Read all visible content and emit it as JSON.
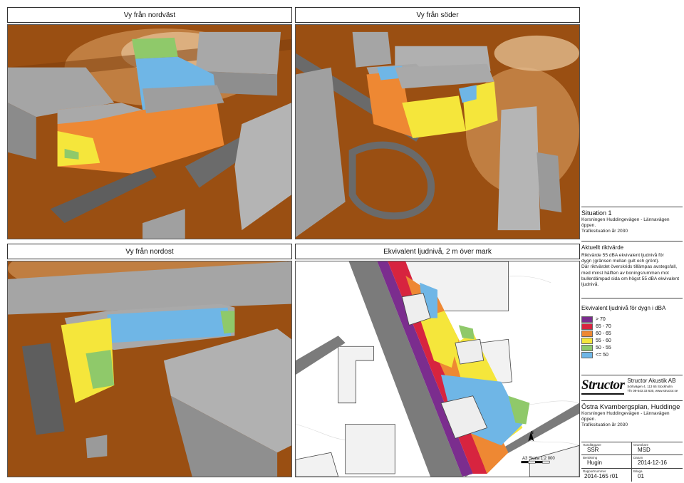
{
  "views": {
    "nw": {
      "title": "Vy från nordväst"
    },
    "s": {
      "title": "Vy från söder"
    },
    "ne": {
      "title": "Vy från nordost"
    },
    "map": {
      "title": "Ekvivalent ljudnivå, 2 m över mark"
    }
  },
  "situation": {
    "heading": "Situation 1",
    "line1": "Korsningen Huddingevägen - Lännavägen",
    "line2": "öppen.",
    "line3": "Trafiksituation år 2030"
  },
  "guideline": {
    "heading": "Aktuellt riktvärde",
    "lines": [
      "Riktvärde 55 dBA ekvivalent ljudnivå för",
      "dygn (gränsen mellan gult och grönt).",
      "Där riktvärdet överskrids tillämpas avstegsfall,",
      "med minst hälften av boningsrummen mot",
      "bullerdämpad sida om högst 55 dBA ekvivalent",
      "ljudnivå."
    ]
  },
  "legend": {
    "heading": "Ekvivalent ljudnivå för dygn i dBA",
    "items": [
      {
        "label": "> 70",
        "color": "#7b2d8e"
      },
      {
        "label": "65 - 70",
        "color": "#d7243f"
      },
      {
        "label": "60 - 65",
        "color": "#ee8833"
      },
      {
        "label": "55 - 60",
        "color": "#f5e63b"
      },
      {
        "label": "50 - 55",
        "color": "#8fc96a"
      },
      {
        "label": "<= 50",
        "color": "#6fb6e6"
      }
    ]
  },
  "company": {
    "logo": "Structor",
    "name": "Structor Akustik AB",
    "address": "Sörkvägen 4, 113 65 Stockholm",
    "contact": "Tfn 08-543 33 630, www.structor.se"
  },
  "project": {
    "title": "Östra Kvarnbergsplan, Huddinge",
    "line1": "Korsningen Huddingevägen - Lännavägen",
    "line2": "öppen.",
    "line3": "Trafiksituation år 2030"
  },
  "map": {
    "scale_text": "A3 Skala 1:2 000",
    "north_label": "N"
  },
  "titleblock": {
    "handlaggare_label": "Handläggare",
    "handlaggare": "SSR",
    "granskare_label": "Granskare",
    "granskare": "MSD",
    "berakning_label": "Beräkning",
    "berakning": "Hugin",
    "datum_label": "Datum",
    "datum": "2014-12-16",
    "rapport_label": "Rapportnummer",
    "rapport": "2014-165 r01",
    "bilaga_label": "Bilaga",
    "bilaga": "01"
  }
}
